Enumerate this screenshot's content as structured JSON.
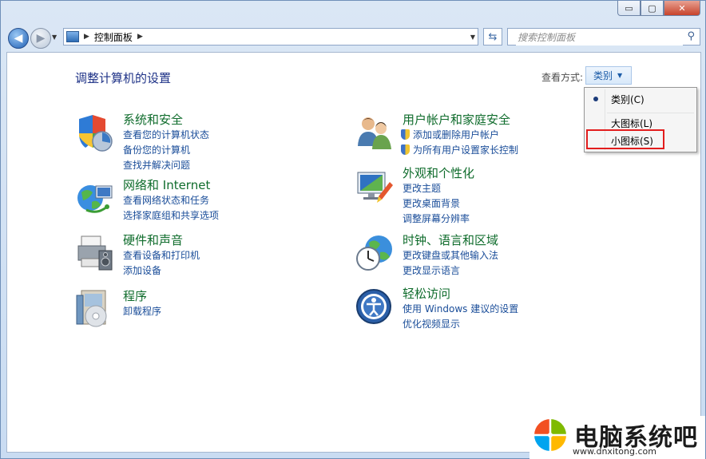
{
  "window": {
    "minimize_label": "▭",
    "maximize_label": "▢",
    "close_label": "✕"
  },
  "nav": {
    "breadcrumb": "控制面板",
    "search_placeholder": "搜索控制面板"
  },
  "content": {
    "page_title": "调整计算机的设置",
    "view_by_label": "查看方式:",
    "view_by_value": "类别"
  },
  "categories": [
    {
      "icon": "system-security-icon",
      "title": "系统和安全",
      "links": [
        "查看您的计算机状态",
        "备份您的计算机",
        "查找并解决问题"
      ]
    },
    {
      "icon": "network-icon",
      "title": "网络和 Internet",
      "links": [
        "查看网络状态和任务",
        "选择家庭组和共享选项"
      ]
    },
    {
      "icon": "hardware-sound-icon",
      "title": "硬件和声音",
      "links": [
        "查看设备和打印机",
        "添加设备"
      ]
    },
    {
      "icon": "programs-icon",
      "title": "程序",
      "links": [
        "卸载程序"
      ]
    },
    {
      "icon": "user-accounts-icon",
      "title": "用户帐户和家庭安全",
      "links": [
        "添加或删除用户帐户",
        "为所有用户设置家长控制"
      ]
    },
    {
      "icon": "appearance-icon",
      "title": "外观和个性化",
      "links": [
        "更改主题",
        "更改桌面背景",
        "调整屏幕分辨率"
      ]
    },
    {
      "icon": "clock-region-icon",
      "title": "时钟、语言和区域",
      "links": [
        "更改键盘或其他输入法",
        "更改显示语言"
      ]
    },
    {
      "icon": "ease-of-access-icon",
      "title": "轻松访问",
      "links": [
        "使用 Windows 建议的设置",
        "优化视频显示"
      ]
    }
  ],
  "menu": {
    "items": [
      "类别(C)",
      "大图标(L)",
      "小图标(S)"
    ],
    "selected": "类别(C)"
  },
  "watermark": {
    "name": "电脑系统吧",
    "url": "www.dnxitong.com",
    "logo_colors": [
      "#f25022",
      "#7fba00",
      "#00a4ef",
      "#ffb900"
    ]
  }
}
